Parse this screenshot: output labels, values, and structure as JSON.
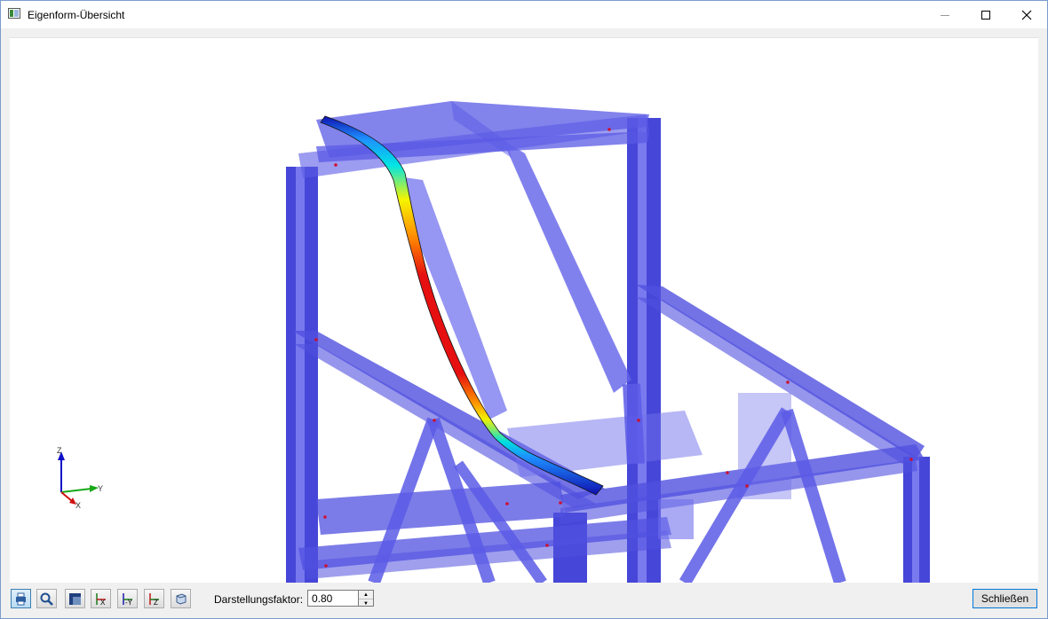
{
  "window": {
    "title": "Eigenform-Übersicht",
    "minimize_icon": "minimize-icon",
    "maximize_icon": "maximize-icon",
    "close_icon": "close-icon"
  },
  "viewport": {
    "axes": {
      "z": "Z",
      "y": "Y",
      "x": "X"
    },
    "colors": {
      "members": "#5a5ae6",
      "members_light": "#9a9af0",
      "deformation_max": "#e61010",
      "deformation_min": "#0a0ab4"
    }
  },
  "toolbar": {
    "buttons": [
      {
        "icon": "print-icon"
      },
      {
        "icon": "zoom-icon"
      },
      {
        "icon": "display-mode-icon"
      },
      {
        "icon": "view-x-icon",
        "label": "X"
      },
      {
        "icon": "view-minus-y-icon",
        "label": "-Y"
      },
      {
        "icon": "view-z-icon",
        "label": "Z"
      },
      {
        "icon": "isometric-view-icon"
      }
    ],
    "factor_label": "Darstellungsfaktor:",
    "factor_value": "0.80",
    "close_label": "Schließen"
  }
}
